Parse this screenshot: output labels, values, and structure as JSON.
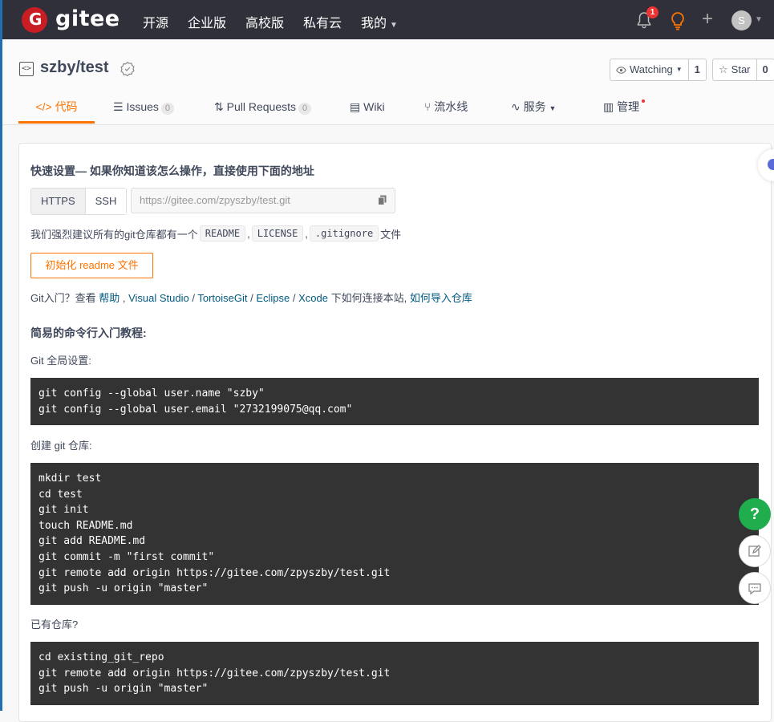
{
  "topbar": {
    "brand": "gitee",
    "nav": [
      "开源",
      "企业版",
      "高校版",
      "私有云",
      "我的"
    ],
    "notification_count": "1",
    "avatar_letter": "S"
  },
  "repo": {
    "title": "szby/test",
    "watch_label": "Watching",
    "watch_count": "1",
    "star_label": "Star",
    "star_count": "0",
    "tabs": [
      {
        "label": "代码",
        "icon": "code-icon"
      },
      {
        "label": "Issues",
        "count": "0",
        "icon": "issue-icon"
      },
      {
        "label": "Pull Requests",
        "count": "0",
        "icon": "pull-request-icon"
      },
      {
        "label": "Wiki",
        "icon": "wiki-icon"
      },
      {
        "label": "流水线",
        "icon": "pipeline-icon"
      },
      {
        "label": "服务",
        "icon": "service-icon"
      },
      {
        "label": "管理",
        "icon": "manage-icon"
      }
    ]
  },
  "quick": {
    "heading": "快速设置— 如果你知道该怎么操作，直接使用下面的地址",
    "protocols": [
      "HTTPS",
      "SSH"
    ],
    "url": "https://gitee.com/zpyszby/test.git",
    "recommend_prefix": "我们强烈建议所有的git仓库都有一个",
    "files": [
      "README",
      "LICENSE",
      ".gitignore"
    ],
    "recommend_suffix": "文件",
    "init_button": "初始化 readme 文件",
    "git_help_prefix": "Git入门？查看 ",
    "git_help_links": [
      "帮助",
      "Visual Studio",
      "TortoiseGit",
      "Eclipse",
      "Xcode"
    ],
    "git_help_mid": " 下如何连接本站, ",
    "git_help_import": "如何导入仓库"
  },
  "tutorial": {
    "heading": "简易的命令行入门教程:",
    "global_label": "Git 全局设置:",
    "global_code": [
      "git config --global user.name \"szby\"",
      "git config --global user.email \"2732199075@qq.com\""
    ],
    "create_label": "创建 git 仓库:",
    "create_code": [
      "mkdir test",
      "cd test",
      "git init",
      "touch README.md",
      "git add README.md",
      "git commit -m \"first commit\"",
      "git remote add origin https://gitee.com/zpyszby/test.git",
      "git push -u origin \"master\""
    ],
    "existing_label": "已有仓库?",
    "existing_code": [
      "cd existing_git_repo",
      "git remote add origin https://gitee.com/zpyszby/test.git",
      "git push -u origin \"master\""
    ]
  },
  "floating": {
    "help": "?"
  },
  "colors": {
    "accent": "#fe7300",
    "nav_bg": "#2f3039",
    "code_bg": "#333333",
    "help_green": "#1fad4e",
    "brand_red": "#c71d23"
  }
}
